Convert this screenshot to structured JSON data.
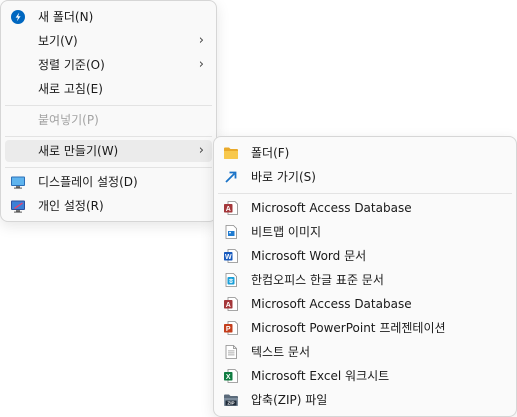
{
  "main_menu": {
    "items": [
      {
        "label": "새 폴더(N)"
      },
      {
        "label": "보기(V)"
      },
      {
        "label": "정렬 기준(O)"
      },
      {
        "label": "새로 고침(E)"
      },
      {
        "label": "붙여넣기(P)"
      },
      {
        "label": "새로 만들기(W)"
      },
      {
        "label": "디스플레이 설정(D)"
      },
      {
        "label": "개인 설정(R)"
      }
    ],
    "arrow": "›"
  },
  "sub_menu": {
    "items": [
      {
        "label": "폴더(F)",
        "icon": "folder-icon"
      },
      {
        "label": "바로 가기(S)",
        "icon": "shortcut-icon"
      },
      {
        "label": "Microsoft Access Database",
        "icon": "access-icon"
      },
      {
        "label": "비트맵 이미지",
        "icon": "bitmap-icon"
      },
      {
        "label": "Microsoft Word 문서",
        "icon": "word-icon"
      },
      {
        "label": "한컴오피스 한글 표준 문서",
        "icon": "hwp-icon"
      },
      {
        "label": "Microsoft Access Database",
        "icon": "access-icon"
      },
      {
        "label": "Microsoft PowerPoint 프레젠테이션",
        "icon": "powerpoint-icon"
      },
      {
        "label": "텍스트 문서",
        "icon": "text-document-icon"
      },
      {
        "label": "Microsoft Excel 워크시트",
        "icon": "excel-icon"
      },
      {
        "label": "압축(ZIP) 파일",
        "icon": "zip-icon"
      }
    ]
  },
  "colors": {
    "accent": "#0067c0",
    "folder": "#f6c445",
    "access": "#a4373a",
    "word": "#185abd",
    "excel": "#107c41",
    "powerpoint": "#c43e1c",
    "hwp": "#1a9fd8"
  }
}
